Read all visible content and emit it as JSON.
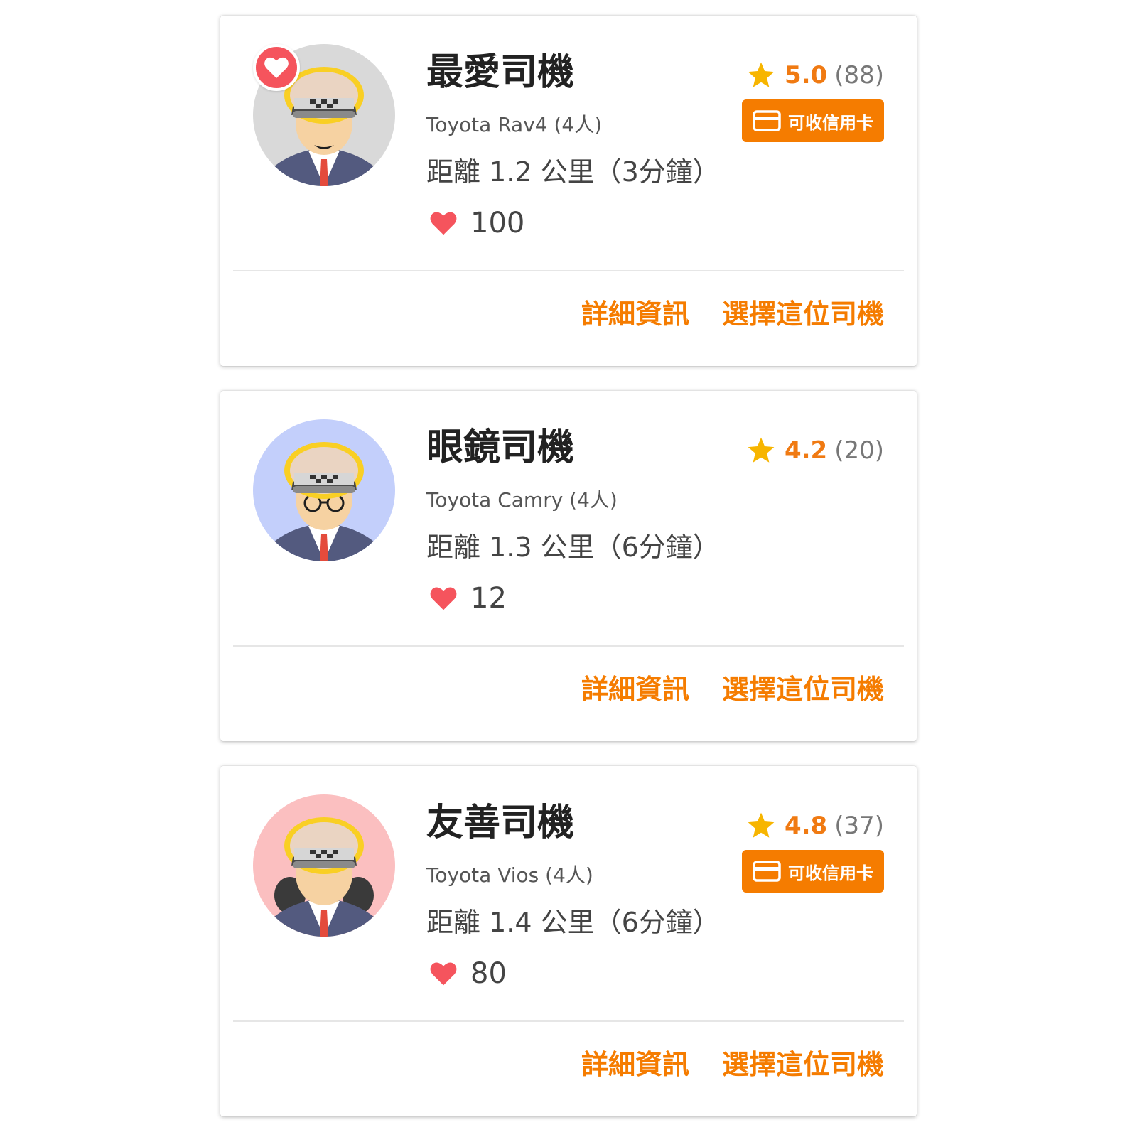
{
  "colors": {
    "accent": "#f57c00",
    "rating_text": "#f07a12",
    "star": "#f7b500",
    "heart": "#f5545d",
    "title": "#222222",
    "text": "#444444"
  },
  "drivers": [
    {
      "name": "最愛司機",
      "car": "Toyota Rav4 (4人)",
      "distance": "距離 1.2 公里（3分鐘）",
      "likes": "100",
      "rating": "5.0",
      "reviews": "(88)",
      "accepts_card": true,
      "card_badge": "可收信用卡",
      "favorite": true,
      "avatar_bg": "#d9d9d9",
      "avatar_variant": "smiling-driver",
      "actions": {
        "details": "詳細資訊",
        "select": "選擇這位司機"
      }
    },
    {
      "name": "眼鏡司機",
      "car": "Toyota Camry (4人)",
      "distance": "距離 1.3 公里（6分鐘）",
      "likes": "12",
      "rating": "4.2",
      "reviews": "(20)",
      "accepts_card": false,
      "favorite": false,
      "avatar_bg": "#c3cffb",
      "avatar_variant": "glasses-driver",
      "actions": {
        "details": "詳細資訊",
        "select": "選擇這位司機"
      }
    },
    {
      "name": "友善司機",
      "car": "Toyota Vios (4人)",
      "distance": "距離 1.4 公里（6分鐘）",
      "likes": "80",
      "rating": "4.8",
      "reviews": "(37)",
      "accepts_card": true,
      "card_badge": "可收信用卡",
      "favorite": false,
      "avatar_bg": "#fbbfc0",
      "avatar_variant": "long-hair-driver",
      "actions": {
        "details": "詳細資訊",
        "select": "選擇這位司機"
      }
    }
  ]
}
